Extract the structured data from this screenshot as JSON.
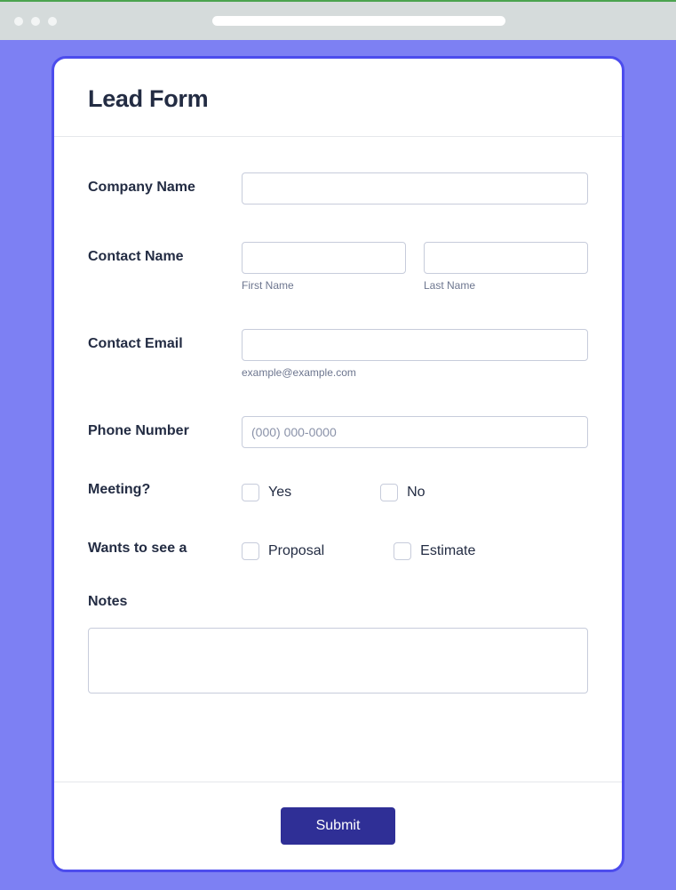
{
  "form": {
    "title": "Lead Form",
    "fields": {
      "company_name": {
        "label": "Company Name"
      },
      "contact_name": {
        "label": "Contact Name",
        "first_sublabel": "First Name",
        "last_sublabel": "Last Name"
      },
      "contact_email": {
        "label": "Contact Email",
        "sublabel": "example@example.com"
      },
      "phone": {
        "label": "Phone Number",
        "placeholder": "(000) 000-0000"
      },
      "meeting": {
        "label": "Meeting?",
        "option_yes": "Yes",
        "option_no": "No"
      },
      "wants": {
        "label": "Wants to see a",
        "option_proposal": "Proposal",
        "option_estimate": "Estimate"
      },
      "notes": {
        "label": "Notes"
      }
    },
    "submit_label": "Submit"
  }
}
